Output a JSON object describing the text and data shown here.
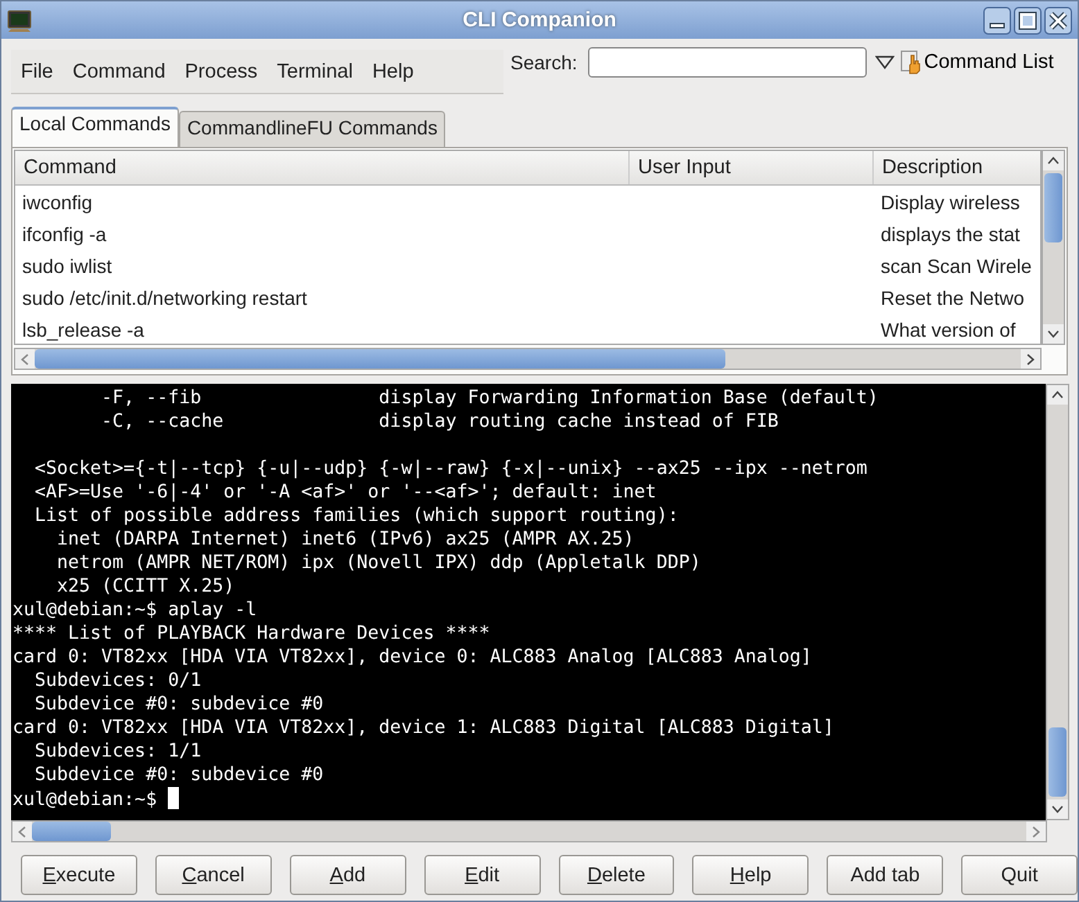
{
  "window": {
    "title": "CLI Companion"
  },
  "menu": [
    "File",
    "Command",
    "Process",
    "Terminal",
    "Help"
  ],
  "search": {
    "label": "Search:"
  },
  "command_list_button": {
    "label": "Command List"
  },
  "tabs": [
    {
      "label": "Local Commands",
      "selected": true
    },
    {
      "label": "CommandlineFU Commands",
      "selected": false
    }
  ],
  "table": {
    "columns": [
      "Command",
      "User Input",
      "Description"
    ],
    "rows": [
      {
        "command": "iwconfig",
        "description": "Display wireless"
      },
      {
        "command": "ifconfig -a",
        "description": "displays the stat"
      },
      {
        "command": "sudo iwlist",
        "description": "scan Scan Wirele"
      },
      {
        "command": "sudo /etc/init.d/networking restart",
        "description": "Reset the Netwo"
      },
      {
        "command": "lsb_release -a",
        "description": "What version of"
      }
    ]
  },
  "terminal": {
    "lines": [
      {
        "kind": "text",
        "text": "        -F, --fib                display Forwarding Information Base (default)"
      },
      {
        "kind": "text",
        "text": "        -C, --cache              display routing cache instead of FIB"
      },
      {
        "kind": "blank"
      },
      {
        "kind": "text",
        "text": "  <Socket>={-t|--tcp} {-u|--udp} {-w|--raw} {-x|--unix} --ax25 --ipx --netrom"
      },
      {
        "kind": "text",
        "text": "  <AF>=Use '-6|-4' or '-A <af>' or '--<af>'; default: inet"
      },
      {
        "kind": "text",
        "text": "  List of possible address families (which support routing):"
      },
      {
        "kind": "text",
        "text": "    inet (DARPA Internet) inet6 (IPv6) ax25 (AMPR AX.25)"
      },
      {
        "kind": "text",
        "text": "    netrom (AMPR NET/ROM) ipx (Novell IPX) ddp (Appletalk DDP)"
      },
      {
        "kind": "text",
        "text": "    x25 (CCITT X.25)"
      },
      {
        "kind": "text",
        "text": "xul@debian:~$ aplay -l"
      },
      {
        "kind": "text",
        "text": "**** List of PLAYBACK Hardware Devices ****"
      },
      {
        "kind": "text",
        "text": "card 0: VT82xx [HDA VIA VT82xx], device 0: ALC883 Analog [ALC883 Analog]"
      },
      {
        "kind": "text",
        "text": "  Subdevices: 0/1"
      },
      {
        "kind": "text",
        "text": "  Subdevice #0: subdevice #0"
      },
      {
        "kind": "text",
        "text": "card 0: VT82xx [HDA VIA VT82xx], device 1: ALC883 Digital [ALC883 Digital]"
      },
      {
        "kind": "text",
        "text": "  Subdevices: 1/1"
      },
      {
        "kind": "text",
        "text": "  Subdevice #0: subdevice #0"
      }
    ],
    "prompt": "xul@debian:~$"
  },
  "buttons": [
    {
      "label": "Execute",
      "mnemonic": true
    },
    {
      "label": "Cancel",
      "mnemonic": true
    },
    {
      "label": "Add",
      "mnemonic": true
    },
    {
      "label": "Edit",
      "mnemonic": true
    },
    {
      "label": "Delete",
      "mnemonic": true
    },
    {
      "label": "Help",
      "mnemonic": true
    },
    {
      "label": "Add tab",
      "mnemonic": false
    },
    {
      "label": "Quit",
      "mnemonic": false
    }
  ]
}
